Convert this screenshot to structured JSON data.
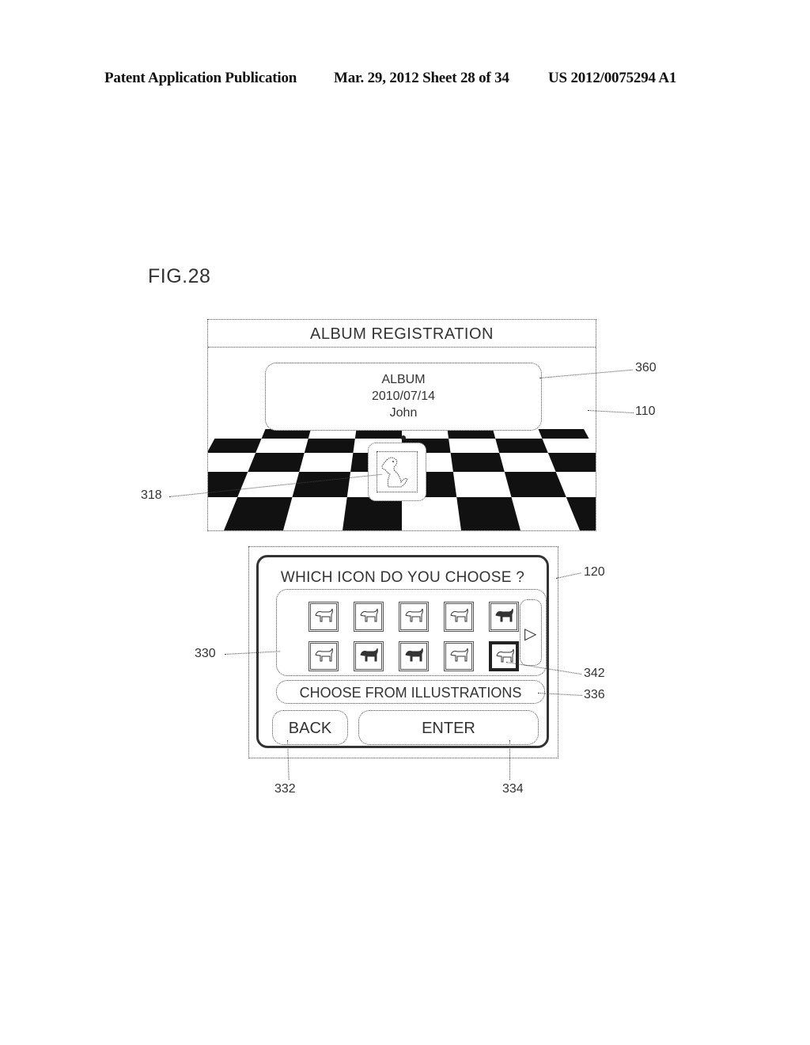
{
  "header": {
    "publication": "Patent Application Publication",
    "date_sheet": "Mar. 29, 2012  Sheet 28 of 34",
    "patent_number": "US 2012/0075294 A1"
  },
  "figure": {
    "label": "FIG.28"
  },
  "upper_screen": {
    "ref": "110",
    "title": "ALBUM REGISTRATION",
    "info_box": {
      "ref": "360",
      "lines": [
        "ALBUM",
        "2010/07/14",
        "John"
      ]
    },
    "album_icon": {
      "ref": "318",
      "icon": "dog-sitting-icon"
    }
  },
  "lower_screen": {
    "ref": "120",
    "question": "WHICH ICON DO YOU CHOOSE ?",
    "icon_grid": {
      "ref": "330",
      "icons": [
        {
          "name": "dog-1-icon",
          "selected": false
        },
        {
          "name": "dog-2-icon",
          "selected": false
        },
        {
          "name": "dog-3-icon",
          "selected": false
        },
        {
          "name": "dog-4-icon",
          "selected": false
        },
        {
          "name": "dog-5-icon",
          "selected": false
        },
        {
          "name": "dog-6-icon",
          "selected": false
        },
        {
          "name": "dog-7-icon",
          "selected": false
        },
        {
          "name": "dog-8-icon",
          "selected": false
        },
        {
          "name": "dog-9-icon",
          "selected": false
        },
        {
          "name": "dog-10-icon",
          "selected": true
        }
      ],
      "selected_ref": "342",
      "next_arrow": "▷"
    },
    "choose_illustrations": {
      "label": "CHOOSE FROM ILLUSTRATIONS",
      "ref": "336"
    },
    "back_button": {
      "label": "BACK",
      "ref": "332"
    },
    "enter_button": {
      "label": "ENTER",
      "ref": "334"
    }
  }
}
